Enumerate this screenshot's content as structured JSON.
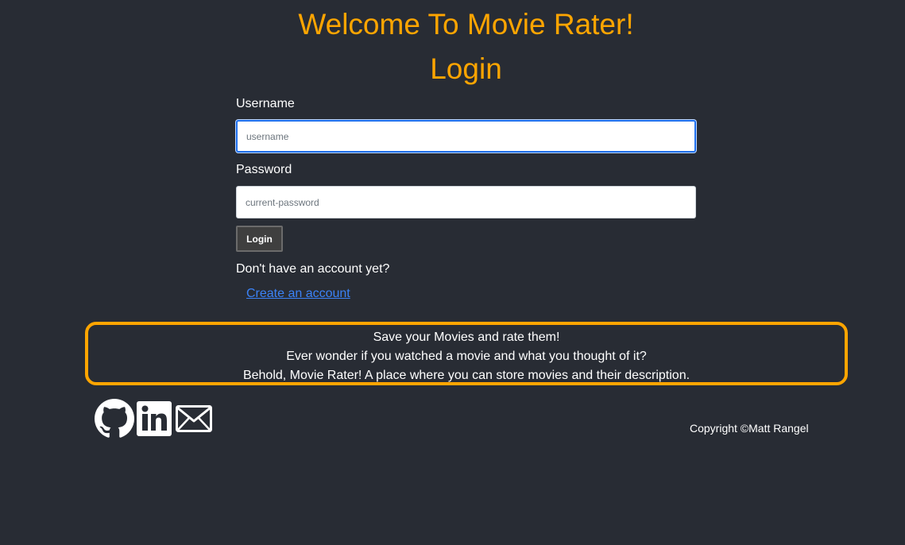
{
  "header": {
    "welcome_title": "Welcome To Movie Rater!",
    "page_title": "Login"
  },
  "form": {
    "username_label": "Username",
    "username_placeholder": "username",
    "username_value": "",
    "password_label": "Password",
    "password_placeholder": "current-password",
    "password_value": "",
    "login_button": "Login",
    "no_account_text": "Don't have an account yet?",
    "create_account_link": "Create an account"
  },
  "info": {
    "lines": [
      "Save your Movies and rate them!",
      "Ever wonder if you watched a movie and what you thought of it?",
      "Behold, Movie Rater! A place where you can store movies and their description."
    ]
  },
  "footer": {
    "icons": [
      "github-icon",
      "linkedin-icon",
      "mail-icon"
    ],
    "copyright": "Copyright ©Matt Rangel"
  },
  "colors": {
    "background": "#282c34",
    "accent": "#ffa500",
    "link": "#3b82f6"
  }
}
